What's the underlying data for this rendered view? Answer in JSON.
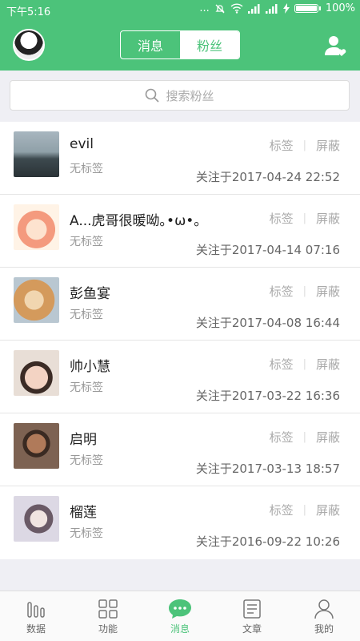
{
  "status_bar": {
    "time": "下午5:16",
    "dots": "...",
    "battery": "100%"
  },
  "header": {
    "tabs": [
      {
        "label": "消息",
        "active": false
      },
      {
        "label": "粉丝",
        "active": true
      }
    ],
    "accent": "#4cc37a"
  },
  "search": {
    "placeholder": "搜索粉丝"
  },
  "followers": [
    {
      "name": "evil",
      "tag": "无标签",
      "followed": "关注于2017-04-24 22:52",
      "tag_action": "标签",
      "block_action": "屏蔽",
      "avatar_color": "#6f8792"
    },
    {
      "name": "A...虎哥很暖呦｡•ω•｡",
      "tag": "无标签",
      "followed": "关注于2017-04-14 07:16",
      "tag_action": "标签",
      "block_action": "屏蔽",
      "avatar_color": "#f7b7a0"
    },
    {
      "name": "彭鱼宴",
      "tag": "无标签",
      "followed": "关注于2017-04-08 16:44",
      "tag_action": "标签",
      "block_action": "屏蔽",
      "avatar_color": "#d3a06a"
    },
    {
      "name": "帅小慧",
      "tag": "无标签",
      "followed": "关注于2017-03-22 16:36",
      "tag_action": "标签",
      "block_action": "屏蔽",
      "avatar_color": "#e6c5b8"
    },
    {
      "name": "启明",
      "tag": "无标签",
      "followed": "关注于2017-03-13 18:57",
      "tag_action": "标签",
      "block_action": "屏蔽",
      "avatar_color": "#6b4e3c"
    },
    {
      "name": "榴莲",
      "tag": "无标签",
      "followed": "关注于2016-09-22 10:26",
      "tag_action": "标签",
      "block_action": "屏蔽",
      "avatar_color": "#c9c4d6"
    }
  ],
  "tabbar": [
    {
      "label": "数据",
      "icon": "bars-icon",
      "active": false
    },
    {
      "label": "功能",
      "icon": "grid-icon",
      "active": false
    },
    {
      "label": "消息",
      "icon": "chat-icon",
      "active": true
    },
    {
      "label": "文章",
      "icon": "article-icon",
      "active": false
    },
    {
      "label": "我的",
      "icon": "person-icon",
      "active": false
    }
  ]
}
